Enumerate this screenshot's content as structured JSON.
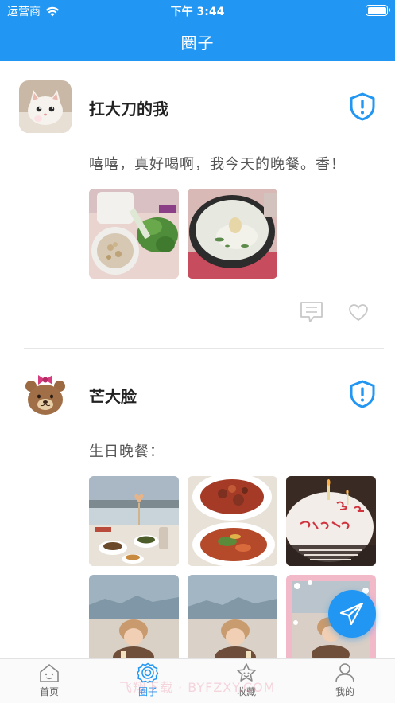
{
  "status_bar": {
    "carrier": "运营商",
    "time": "下午 3:44"
  },
  "header": {
    "title": "圈子"
  },
  "posts": [
    {
      "username": "扛大刀的我",
      "text": "嘻嘻，真好喝啊，我今天的晚餐。香！",
      "avatar": "white-cat-avatar",
      "photos": [
        "food-prep-photo",
        "soup-pot-photo"
      ]
    },
    {
      "username": "芒大脸",
      "text": "生日晚餐：",
      "avatar": "brown-bear-avatar",
      "photos": [
        "restaurant-table-photo",
        "dishes-photo",
        "birthday-cake-photo",
        "child-birthday-photo-1",
        "child-birthday-photo-2",
        "child-birthday-photo-3"
      ]
    }
  ],
  "tabbar": {
    "items": [
      {
        "label": "首页",
        "icon": "home-icon"
      },
      {
        "label": "圈子",
        "icon": "circle-icon"
      },
      {
        "label": "收藏",
        "icon": "star-icon"
      },
      {
        "label": "我的",
        "icon": "person-icon"
      }
    ],
    "active_index": 1
  },
  "watermark": "飞翔下载 · BYFZXY.COM",
  "colors": {
    "primary": "#2196f3",
    "background": "#ffffff"
  }
}
